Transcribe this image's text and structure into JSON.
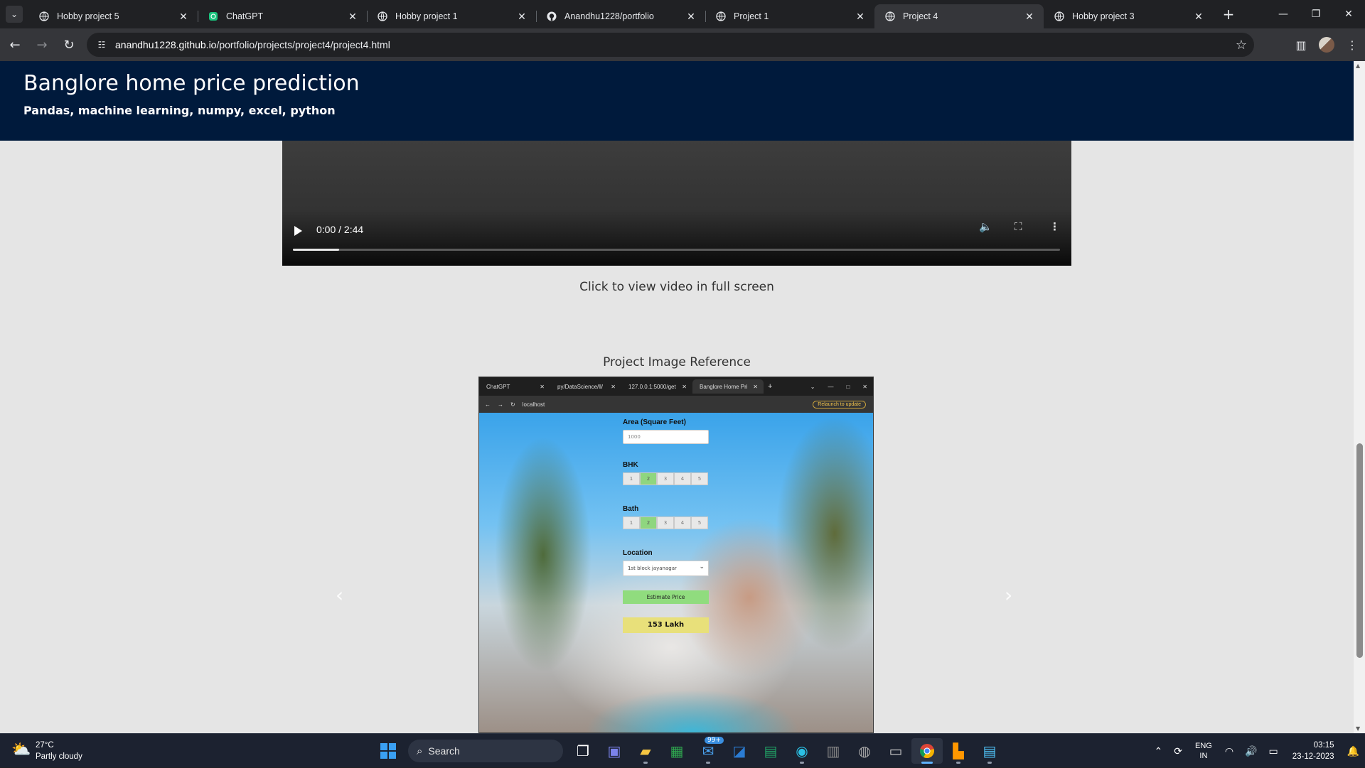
{
  "browser": {
    "tabs": [
      {
        "title": "Hobby project 5",
        "icon": "globe-icon",
        "active": false
      },
      {
        "title": "ChatGPT",
        "icon": "chatgpt-icon",
        "active": false
      },
      {
        "title": "Hobby project 1",
        "icon": "globe-icon",
        "active": false
      },
      {
        "title": "Anandhu1228/portfolio",
        "icon": "github-icon",
        "active": false
      },
      {
        "title": "Project 1",
        "icon": "globe-icon",
        "active": false
      },
      {
        "title": "Project 4",
        "icon": "globe-icon",
        "active": true
      },
      {
        "title": "Hobby project 3",
        "icon": "globe-icon",
        "active": false
      }
    ],
    "url_host": "anandhu1228.github.io",
    "url_path": "/portfolio/projects/project4/project4.html"
  },
  "page": {
    "title": "Banglore home price prediction",
    "subtitle": "Pandas, machine learning, numpy, excel, python",
    "video": {
      "time": "0:00 / 2:44",
      "progress": 0.06
    },
    "video_caption": "Click to view video in full screen",
    "image_caption": "Project Image Reference"
  },
  "embedded_screenshot": {
    "tabs": [
      "ChatGPT",
      "py/DataScience/ll/",
      "127.0.0.1:5000/get",
      "Banglore Home Pri"
    ],
    "url": "localhost",
    "relaunch": "Relaunch to update",
    "area_label": "Area (Square Feet)",
    "area_value": "1000",
    "bhk_label": "BHK",
    "bhk_options": [
      "1",
      "2",
      "3",
      "4",
      "5"
    ],
    "bath_label": "Bath",
    "bath_options": [
      "1",
      "2",
      "3",
      "4",
      "5"
    ],
    "location_label": "Location",
    "location_value": "1st block jayanagar",
    "estimate_button": "Estimate Price",
    "result": "153 Lakh"
  },
  "taskbar": {
    "temperature": "27°C",
    "weather": "Partly cloudy",
    "search_placeholder": "Search",
    "mail_badge": "99+",
    "lang_top": "ENG",
    "lang_bottom": "IN",
    "time": "03:15",
    "date": "23-12-2023"
  }
}
